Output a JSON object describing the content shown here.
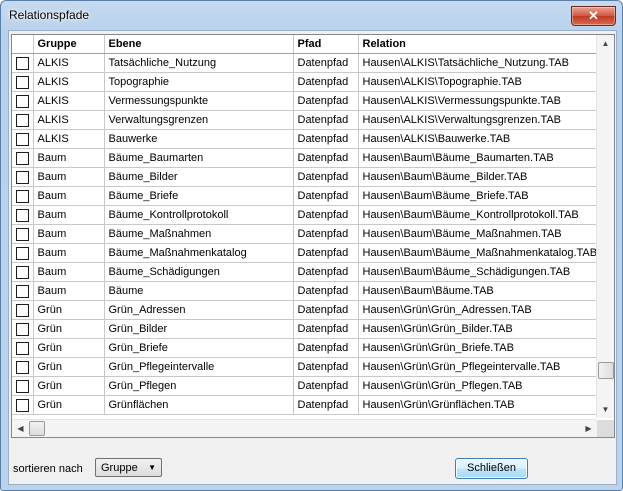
{
  "window": {
    "title": "Relationspfade",
    "close_glyph": "✕"
  },
  "table": {
    "columns": [
      "Gruppe",
      "Ebene",
      "Pfad",
      "Relation"
    ],
    "rows": [
      [
        "ALKIS",
        "Tatsächliche_Nutzung",
        "Datenpfad",
        "Hausen\\ALKIS\\Tatsächliche_Nutzung.TAB"
      ],
      [
        "ALKIS",
        "Topographie",
        "Datenpfad",
        "Hausen\\ALKIS\\Topographie.TAB"
      ],
      [
        "ALKIS",
        "Vermessungspunkte",
        "Datenpfad",
        "Hausen\\ALKIS\\Vermessungspunkte.TAB"
      ],
      [
        "ALKIS",
        "Verwaltungsgrenzen",
        "Datenpfad",
        "Hausen\\ALKIS\\Verwaltungsgrenzen.TAB"
      ],
      [
        "ALKIS",
        "Bauwerke",
        "Datenpfad",
        "Hausen\\ALKIS\\Bauwerke.TAB"
      ],
      [
        "Baum",
        "Bäume_Baumarten",
        "Datenpfad",
        "Hausen\\Baum\\Bäume_Baumarten.TAB"
      ],
      [
        "Baum",
        "Bäume_Bilder",
        "Datenpfad",
        "Hausen\\Baum\\Bäume_Bilder.TAB"
      ],
      [
        "Baum",
        "Bäume_Briefe",
        "Datenpfad",
        "Hausen\\Baum\\Bäume_Briefe.TAB"
      ],
      [
        "Baum",
        "Bäume_Kontrollprotokoll",
        "Datenpfad",
        "Hausen\\Baum\\Bäume_Kontrollprotokoll.TAB"
      ],
      [
        "Baum",
        "Bäume_Maßnahmen",
        "Datenpfad",
        "Hausen\\Baum\\Bäume_Maßnahmen.TAB"
      ],
      [
        "Baum",
        "Bäume_Maßnahmenkatalog",
        "Datenpfad",
        "Hausen\\Baum\\Bäume_Maßnahmenkatalog.TAB"
      ],
      [
        "Baum",
        "Bäume_Schädigungen",
        "Datenpfad",
        "Hausen\\Baum\\Bäume_Schädigungen.TAB"
      ],
      [
        "Baum",
        "Bäume",
        "Datenpfad",
        "Hausen\\Baum\\Bäume.TAB"
      ],
      [
        "Grün",
        "Grün_Adressen",
        "Datenpfad",
        "Hausen\\Grün\\Grün_Adressen.TAB"
      ],
      [
        "Grün",
        "Grün_Bilder",
        "Datenpfad",
        "Hausen\\Grün\\Grün_Bilder.TAB"
      ],
      [
        "Grün",
        "Grün_Briefe",
        "Datenpfad",
        "Hausen\\Grün\\Grün_Briefe.TAB"
      ],
      [
        "Grün",
        "Grün_Pflegeintervalle",
        "Datenpfad",
        "Hausen\\Grün\\Grün_Pflegeintervalle.TAB"
      ],
      [
        "Grün",
        "Grün_Pflegen",
        "Datenpfad",
        "Hausen\\Grün\\Grün_Pflegen.TAB"
      ],
      [
        "Grün",
        "Grünflächen",
        "Datenpfad",
        "Hausen\\Grün\\Grünflächen.TAB"
      ]
    ]
  },
  "footer": {
    "sort_label": "sortieren nach",
    "sort_value": "Gruppe",
    "close_button": "Schließen"
  },
  "icons": {
    "scroll_up": "▲",
    "scroll_down": "▼",
    "scroll_left": "◀",
    "scroll_right": "▶",
    "dropdown": "▼"
  }
}
